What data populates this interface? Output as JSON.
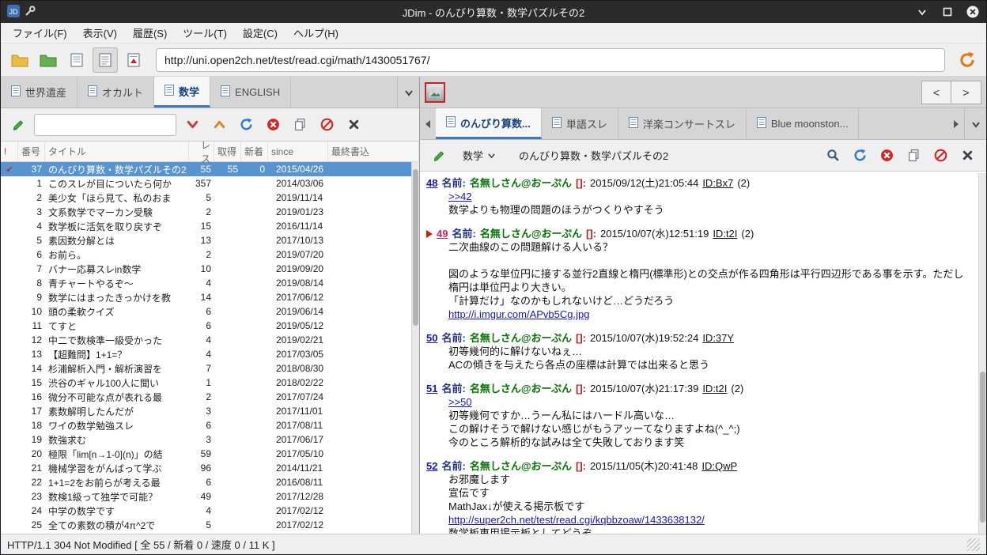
{
  "window": {
    "title": "JDim - のんびり算数・数学パズルその2"
  },
  "menubar": {
    "items": [
      "ファイル(F)",
      "表示(V)",
      "履歴(S)",
      "ツール(T)",
      "設定(C)",
      "ヘルプ(H)"
    ]
  },
  "toolbar": {
    "url": "http://uni.open2ch.net/test/read.cgi/math/1430051767/"
  },
  "icons": {
    "app": "jdim-logo",
    "wrench": "wrench-icon",
    "minimize": "chevron-down",
    "maximize": "square",
    "close": "circle-x",
    "folders": [
      "yellow-folder",
      "green-folder"
    ],
    "views": [
      "board-view",
      "thread-view",
      "favorites-view"
    ],
    "filter": [
      "write",
      "scroll-down",
      "scroll-up",
      "reload",
      "stop",
      "copy",
      "ng",
      "delete"
    ],
    "thread": [
      "write",
      "search",
      "reload",
      "stop",
      "copy",
      "ng",
      "close"
    ]
  },
  "board_pane": {
    "tabs": [
      {
        "label": "世界遺産",
        "active": false
      },
      {
        "label": "オカルト",
        "active": false
      },
      {
        "label": "数学",
        "active": true
      },
      {
        "label": "ENGLISH",
        "active": false
      }
    ],
    "filter_value": "",
    "table": {
      "headers": [
        "!",
        "番号",
        "タイトル",
        "レス",
        "取得",
        "新着",
        "since",
        "最終書込"
      ],
      "rows": [
        {
          "mark": "✔",
          "num": "37",
          "title": "のんびり算数・数学パズルその2",
          "res": "55",
          "got": "55",
          "new": "0",
          "since": "2015/04/26",
          "selected": true
        },
        {
          "num": "1",
          "title": "このスレが目についたら何か",
          "res": "357",
          "since": "2014/03/06"
        },
        {
          "num": "2",
          "title": "美少女「ほら見て、私のおま",
          "res": "5",
          "since": "2019/11/14"
        },
        {
          "num": "3",
          "title": "文系数学でマーカン受験",
          "res": "2",
          "since": "2019/01/23"
        },
        {
          "num": "4",
          "title": "数学板に活気を取り戻すぞ",
          "res": "15",
          "since": "2016/11/14"
        },
        {
          "num": "5",
          "title": "素因数分解とは",
          "res": "13",
          "since": "2017/10/13"
        },
        {
          "num": "6",
          "title": "お前ら。",
          "res": "2",
          "since": "2019/07/20"
        },
        {
          "num": "7",
          "title": "バナー応募スレin数学",
          "res": "10",
          "since": "2019/09/20"
        },
        {
          "num": "8",
          "title": "青チャートやるぞ〜",
          "res": "4",
          "since": "2019/08/14"
        },
        {
          "num": "9",
          "title": "数学にはまったきっかけを教",
          "res": "14",
          "since": "2017/06/12"
        },
        {
          "num": "10",
          "title": "頭の柔軟クイズ",
          "res": "6",
          "since": "2019/06/14"
        },
        {
          "num": "11",
          "title": "てすと",
          "res": "6",
          "since": "2019/05/12"
        },
        {
          "num": "12",
          "title": "中二で数検準一級受かった",
          "res": "4",
          "since": "2019/02/21"
        },
        {
          "num": "13",
          "title": "【超難問】1+1=？",
          "res": "4",
          "since": "2017/03/05"
        },
        {
          "num": "14",
          "title": "杉浦解析入門・解析演習を",
          "res": "7",
          "since": "2018/08/30"
        },
        {
          "num": "15",
          "title": "渋谷のギャル100人に聞い",
          "res": "1",
          "since": "2018/02/22"
        },
        {
          "num": "16",
          "title": "微分不可能な点が表れる最",
          "res": "2",
          "since": "2017/07/24"
        },
        {
          "num": "17",
          "title": "素数解明したんだが",
          "res": "3",
          "since": "2017/11/01"
        },
        {
          "num": "18",
          "title": "ワイの数学勉強スレ",
          "res": "6",
          "since": "2017/08/11"
        },
        {
          "num": "19",
          "title": "数強求む",
          "res": "3",
          "since": "2017/06/17"
        },
        {
          "num": "20",
          "title": "極限「lim[n→1-0](n)」の結",
          "res": "59",
          "since": "2017/05/10"
        },
        {
          "num": "21",
          "title": "機械学習をがんばって学ぶ",
          "res": "96",
          "since": "2014/11/21"
        },
        {
          "num": "22",
          "title": "1+1=2をお前らが考える最",
          "res": "6",
          "since": "2016/08/11"
        },
        {
          "num": "23",
          "title": "数検1級って独学で可能？",
          "res": "49",
          "since": "2017/12/28"
        },
        {
          "num": "24",
          "title": "中学の数学です",
          "res": "4",
          "since": "2017/02/12"
        },
        {
          "num": "25",
          "title": "全ての素数の積が4π^2で",
          "res": "5",
          "since": "2017/02/12"
        }
      ]
    }
  },
  "thread_pane": {
    "nav": {
      "prev": "<",
      "next": ">"
    },
    "tabs": [
      {
        "label": "のんびり算数...",
        "active": true
      },
      {
        "label": "単語スレ",
        "active": false
      },
      {
        "label": "洋楽コンサートスレ",
        "active": false
      },
      {
        "label": "Blue moonston...",
        "active": false
      }
    ],
    "toolbar": {
      "board": "数学",
      "title": "のんびり算数・数学パズルその2"
    },
    "posts": [
      {
        "num": "48",
        "name_label": "名前:",
        "name": "名無しさん@おーぷん",
        "mail": "[]:",
        "date": "2015/09/12(土)21:05:44",
        "id": "ID:Bx7",
        "count": "(2)",
        "lines": [
          {
            "t": "anchor",
            "v": ">>42"
          },
          {
            "t": "text",
            "v": "数学よりも物理の問題のほうがつくりやすそう"
          }
        ]
      },
      {
        "num": "49",
        "marker": true,
        "name_label": "名前:",
        "name": "名無しさん@おーぷん",
        "mail": "[]:",
        "date": "2015/10/07(水)12:51:19",
        "id": "ID:t2I",
        "count": "(2)",
        "lines": [
          {
            "t": "text",
            "v": "二次曲線のこの問題解ける人いる？"
          },
          {
            "t": "blank",
            "v": ""
          },
          {
            "t": "text",
            "v": "図のような単位円に接する並行2直線と楕円(標準形)との交点が作る四角形は平行四辺形である事を示す。ただし楕円は単位円より大きい。"
          },
          {
            "t": "text",
            "v": "「計算だけ」なのかもしれないけど…どうだろう"
          },
          {
            "t": "link",
            "v": "http://i.imgur.com/APvb5Cg.jpg"
          }
        ]
      },
      {
        "num": "50",
        "name_label": "名前:",
        "name": "名無しさん@おーぷん",
        "mail": "[]:",
        "date": "2015/10/07(水)19:52:24",
        "id": "ID:37Y",
        "count": "",
        "lines": [
          {
            "t": "text",
            "v": "初等幾何的に解けないねぇ…"
          },
          {
            "t": "text",
            "v": "ACの傾きを与えたら各点の座標は計算では出来ると思う"
          }
        ]
      },
      {
        "num": "51",
        "name_label": "名前:",
        "name": "名無しさん@おーぷん",
        "mail": "[]:",
        "date": "2015/10/07(水)21:17:39",
        "id": "ID:t2I",
        "count": "(2)",
        "lines": [
          {
            "t": "anchor",
            "v": ">>50"
          },
          {
            "t": "text",
            "v": "初等幾何ですか…うーん私にはハードル高いな…"
          },
          {
            "t": "text",
            "v": "この解けそうで解けない感じがもうアッーてなりますよね(^_^;)"
          },
          {
            "t": "text",
            "v": "今のところ解析的な試みは全て失敗しております笑"
          }
        ]
      },
      {
        "num": "52",
        "name_label": "名前:",
        "name": "名無しさん@おーぷん",
        "mail": "[]:",
        "date": "2015/11/05(木)20:41:48",
        "id": "ID:QwP",
        "count": "",
        "lines": [
          {
            "t": "text",
            "v": "お邪魔します"
          },
          {
            "t": "text",
            "v": "宣伝です"
          },
          {
            "t": "text",
            "v": "MathJax↓が使える掲示板です"
          },
          {
            "t": "link",
            "v": "http://super2ch.net/test/read.cgi/kqbbzoaw/1433638132/"
          },
          {
            "t": "text",
            "v": "数学板専用掲示板としてどうぞ"
          }
        ]
      }
    ]
  },
  "statusbar": {
    "text": "HTTP/1.1 304 Not Modified [ 全 55 / 新着 0 / 速度 0 / 11 K ]"
  },
  "colors": {
    "selection": "#5794d0",
    "link": "#1515c8",
    "name_green": "#067206",
    "alert_red": "#cc2222",
    "active_tab_blue": "#15427e"
  }
}
